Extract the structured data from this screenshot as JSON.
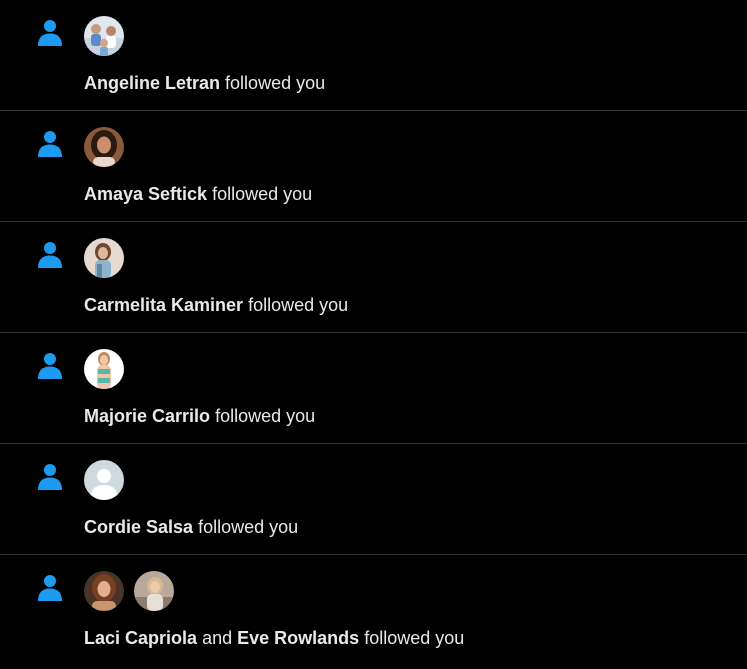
{
  "colors": {
    "background": "#000000",
    "divider": "#2f3336",
    "accent": "#1d9bf0",
    "text": "#e7e9ea"
  },
  "notifications": [
    {
      "icon": "person-icon",
      "names": [
        "Angeline Letran"
      ],
      "connector": "",
      "action": "followed you",
      "avatars": [
        "avatar-group-photo"
      ]
    },
    {
      "icon": "person-icon",
      "names": [
        "Amaya Seftick"
      ],
      "connector": "",
      "action": "followed you",
      "avatars": [
        "avatar-portrait"
      ]
    },
    {
      "icon": "person-icon",
      "names": [
        "Carmelita Kaminer"
      ],
      "connector": "",
      "action": "followed you",
      "avatars": [
        "avatar-portrait"
      ]
    },
    {
      "icon": "person-icon",
      "names": [
        "Majorie Carrilo"
      ],
      "connector": "",
      "action": "followed you",
      "avatars": [
        "avatar-portrait"
      ]
    },
    {
      "icon": "person-icon",
      "names": [
        "Cordie Salsa"
      ],
      "connector": "",
      "action": "followed you",
      "avatars": [
        "default-avatar"
      ]
    },
    {
      "icon": "person-icon",
      "names": [
        "Laci Capriola",
        "Eve Rowlands"
      ],
      "connector": "and",
      "action": "followed you",
      "avatars": [
        "avatar-portrait",
        "avatar-portrait"
      ]
    }
  ]
}
